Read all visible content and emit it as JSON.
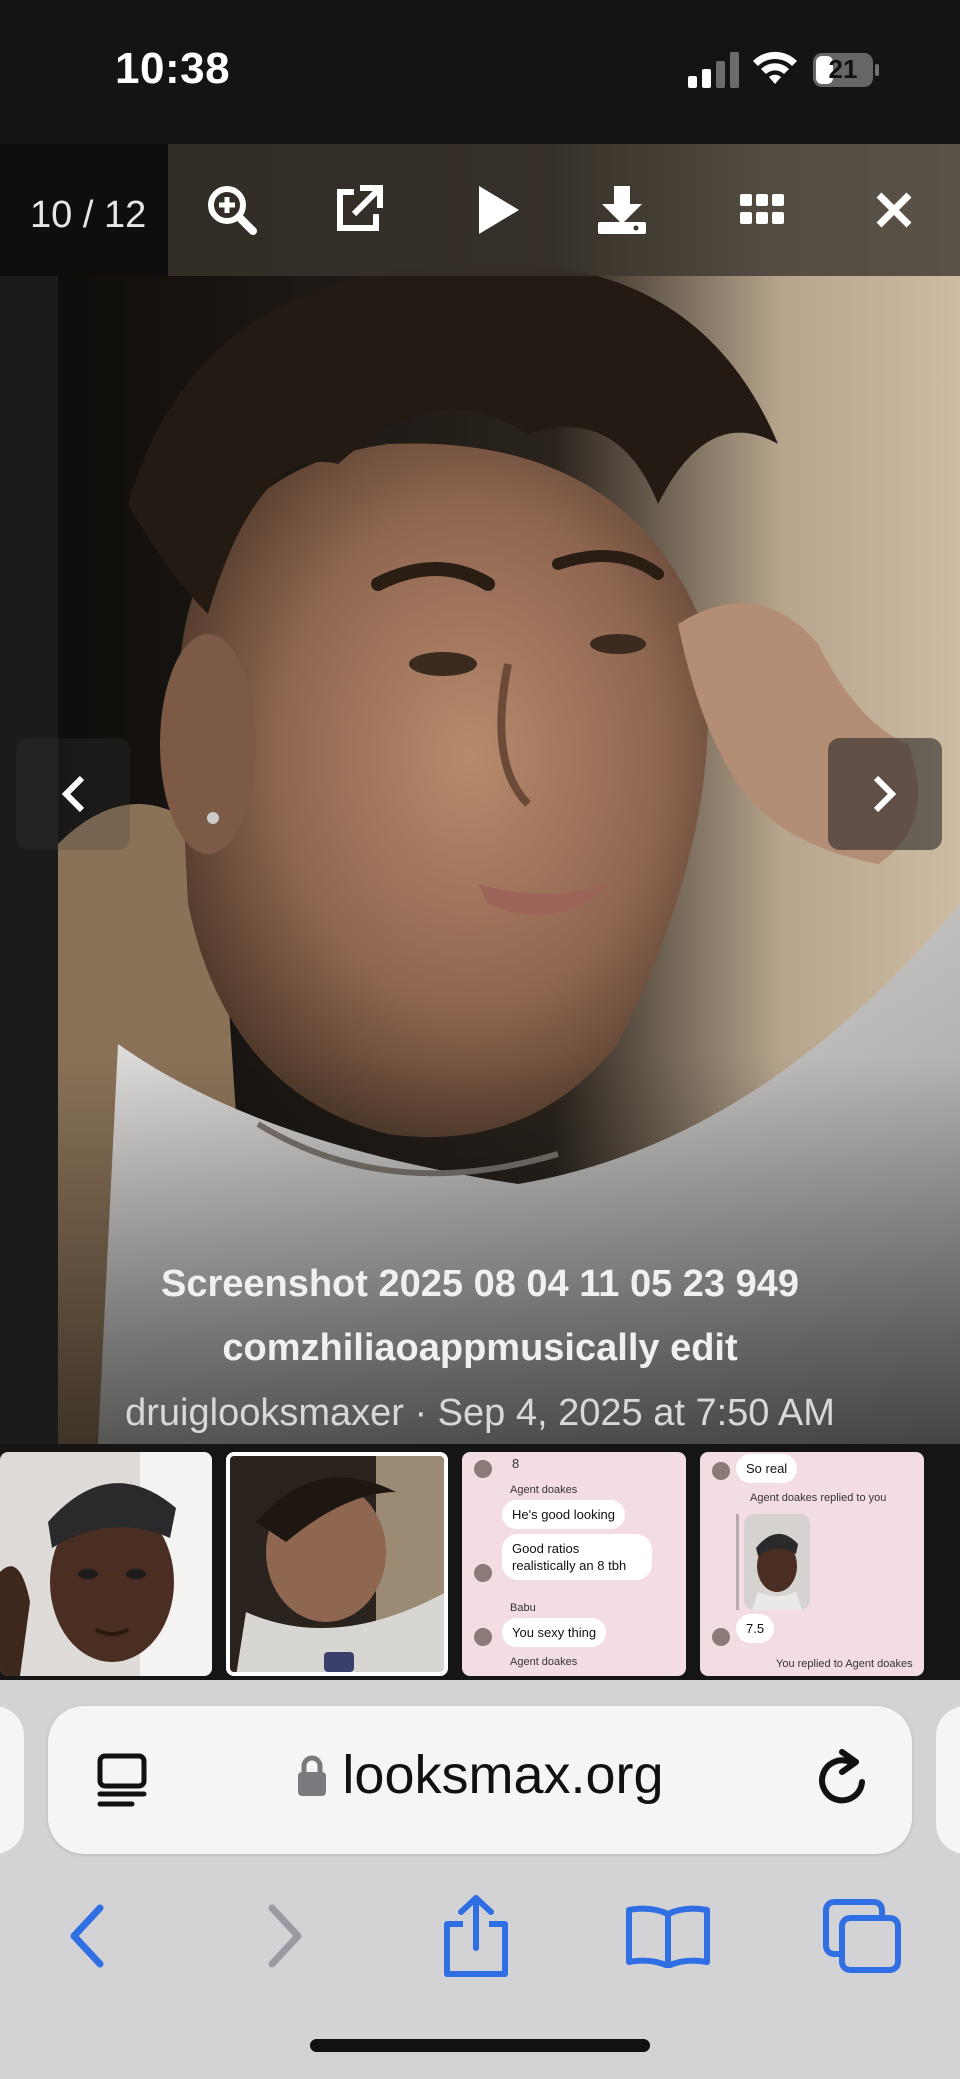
{
  "status_bar": {
    "time": "10:38",
    "battery": "21"
  },
  "lightbox": {
    "counter": "10 / 12",
    "toolbar": {
      "zoom": "zoom-in-icon",
      "open": "open-external-icon",
      "play": "play-icon",
      "download": "download-icon",
      "grid": "grid-icon",
      "close": "close-icon"
    },
    "caption": {
      "title_line1": "Screenshot 2025 08 04 11 05 23 949",
      "title_line2": "comzhiliaoappmusically edit",
      "meta": "druiglooksmaxer · Sep 4, 2025 at 7:50 AM"
    },
    "thumbnails": {
      "chat1": {
        "number": "8",
        "name1": "Agent doakes",
        "bubble1": "He's good looking",
        "bubble2": "Good ratios realistically an 8 tbh",
        "name2": "Babu",
        "bubble3": "You sexy thing",
        "name3": "Agent doakes"
      },
      "chat2": {
        "bubble1": "So real",
        "reply_header": "Agent doakes replied to you",
        "rating": "7.5",
        "reply_footer": "You replied to Agent doakes"
      }
    }
  },
  "browser": {
    "url": "looksmax.org"
  },
  "colors": {
    "accent": "#2f6fe3",
    "disabled": "#9a9aa0"
  }
}
